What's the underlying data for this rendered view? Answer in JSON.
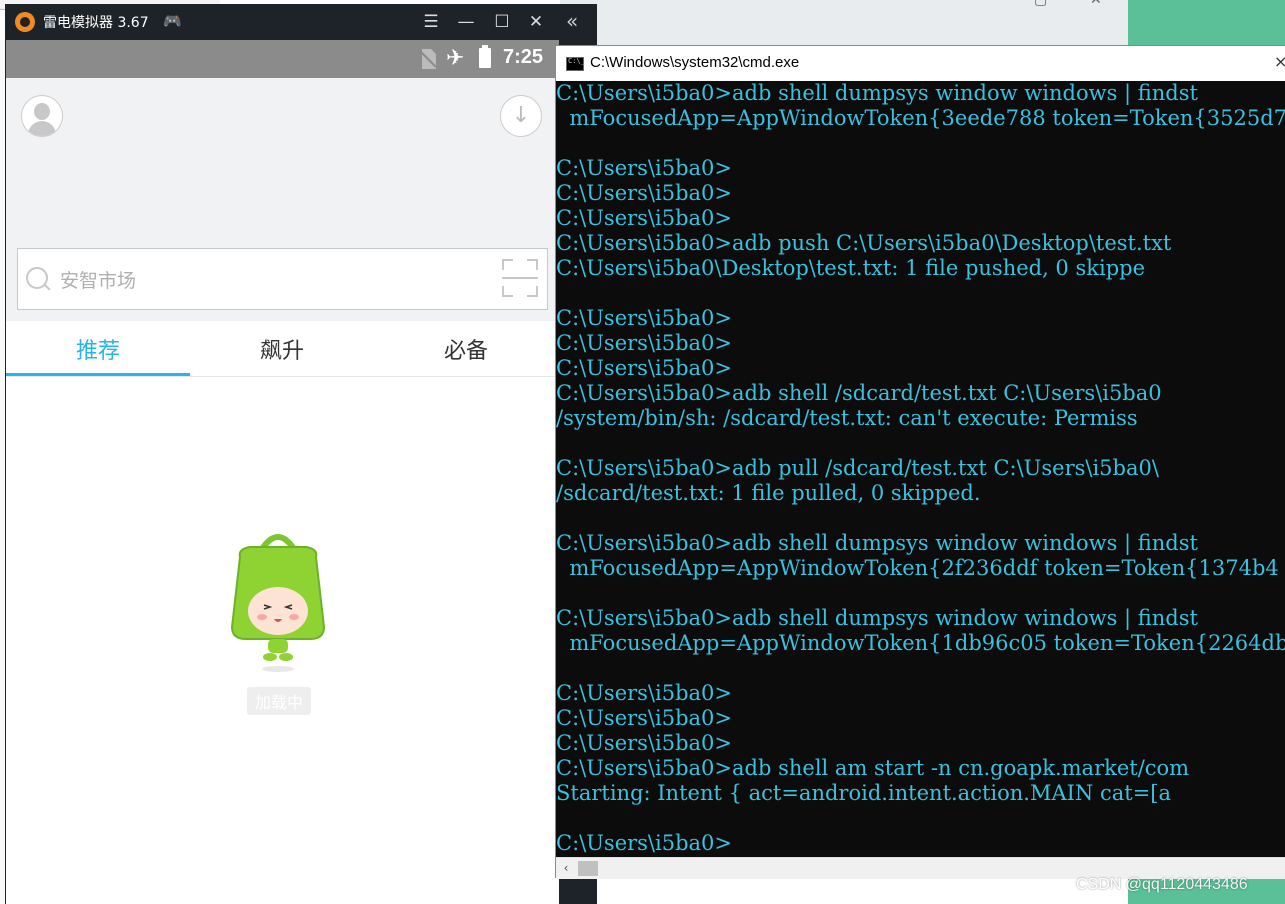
{
  "emulator": {
    "title": "雷电模拟器 3.67",
    "status": {
      "time": "7:25"
    },
    "search": {
      "placeholder": "安智市场"
    },
    "tabs": [
      {
        "label": "推荐",
        "active": true
      },
      {
        "label": "飙升",
        "active": false
      },
      {
        "label": "必备",
        "active": false
      }
    ],
    "loading_label": "加载中",
    "accent_color": "#26b5e8"
  },
  "cmd": {
    "title": "C:\\Windows\\system32\\cmd.exe",
    "lines": [
      "C:\\Users\\i5ba0>adb shell dumpsys window windows | findst",
      "  mFocusedApp=AppWindowToken{3eede788 token=Token{3525d7",
      "",
      "C:\\Users\\i5ba0>",
      "C:\\Users\\i5ba0>",
      "C:\\Users\\i5ba0>",
      "C:\\Users\\i5ba0>adb push C:\\Users\\i5ba0\\Desktop\\test.txt",
      "C:\\Users\\i5ba0\\Desktop\\test.txt: 1 file pushed, 0 skippe",
      "",
      "C:\\Users\\i5ba0>",
      "C:\\Users\\i5ba0>",
      "C:\\Users\\i5ba0>",
      "C:\\Users\\i5ba0>adb shell /sdcard/test.txt C:\\Users\\i5ba0",
      "/system/bin/sh: /sdcard/test.txt: can't execute: Permiss",
      "",
      "C:\\Users\\i5ba0>adb pull /sdcard/test.txt C:\\Users\\i5ba0\\",
      "/sdcard/test.txt: 1 file pulled, 0 skipped.",
      "",
      "C:\\Users\\i5ba0>adb shell dumpsys window windows | findst",
      "  mFocusedApp=AppWindowToken{2f236ddf token=Token{1374b4",
      "",
      "C:\\Users\\i5ba0>adb shell dumpsys window windows | findst",
      "  mFocusedApp=AppWindowToken{1db96c05 token=Token{2264db",
      "",
      "C:\\Users\\i5ba0>",
      "C:\\Users\\i5ba0>",
      "C:\\Users\\i5ba0>",
      "C:\\Users\\i5ba0>adb shell am start -n cn.goapk.market/com",
      "Starting: Intent { act=android.intent.action.MAIN cat=[a",
      "",
      "C:\\Users\\i5ba0>"
    ],
    "text_color": "#3ac1df",
    "background_color": "#0c0c0c"
  },
  "watermark": "CSDN @qq1120443486"
}
